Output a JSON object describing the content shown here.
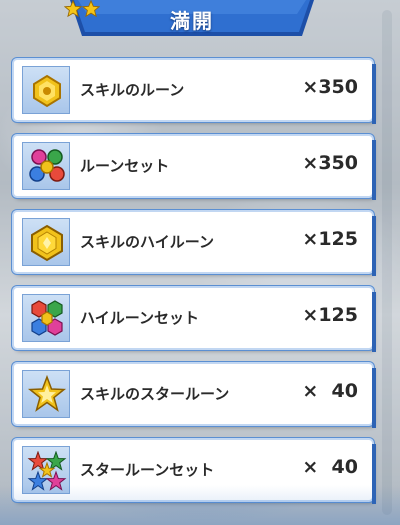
{
  "banner": {
    "title": "満開",
    "star_icon": "gold-star-icon",
    "color": "#2a64c4"
  },
  "items": [
    {
      "icon": "skill-rune-icon",
      "name": "スキルのルーン",
      "quantity": "×350"
    },
    {
      "icon": "rune-set-icon",
      "name": "ルーンセット",
      "quantity": "×350"
    },
    {
      "icon": "skill-high-rune-icon",
      "name": "スキルのハイルーン",
      "quantity": "×125"
    },
    {
      "icon": "high-rune-set-icon",
      "name": "ハイルーンセット",
      "quantity": "×125"
    },
    {
      "icon": "skill-star-rune-icon",
      "name": "スキルのスタールーン",
      "quantity": "×  40"
    },
    {
      "icon": "star-rune-set-icon",
      "name": "スタールーンセット",
      "quantity": "×  40"
    }
  ]
}
